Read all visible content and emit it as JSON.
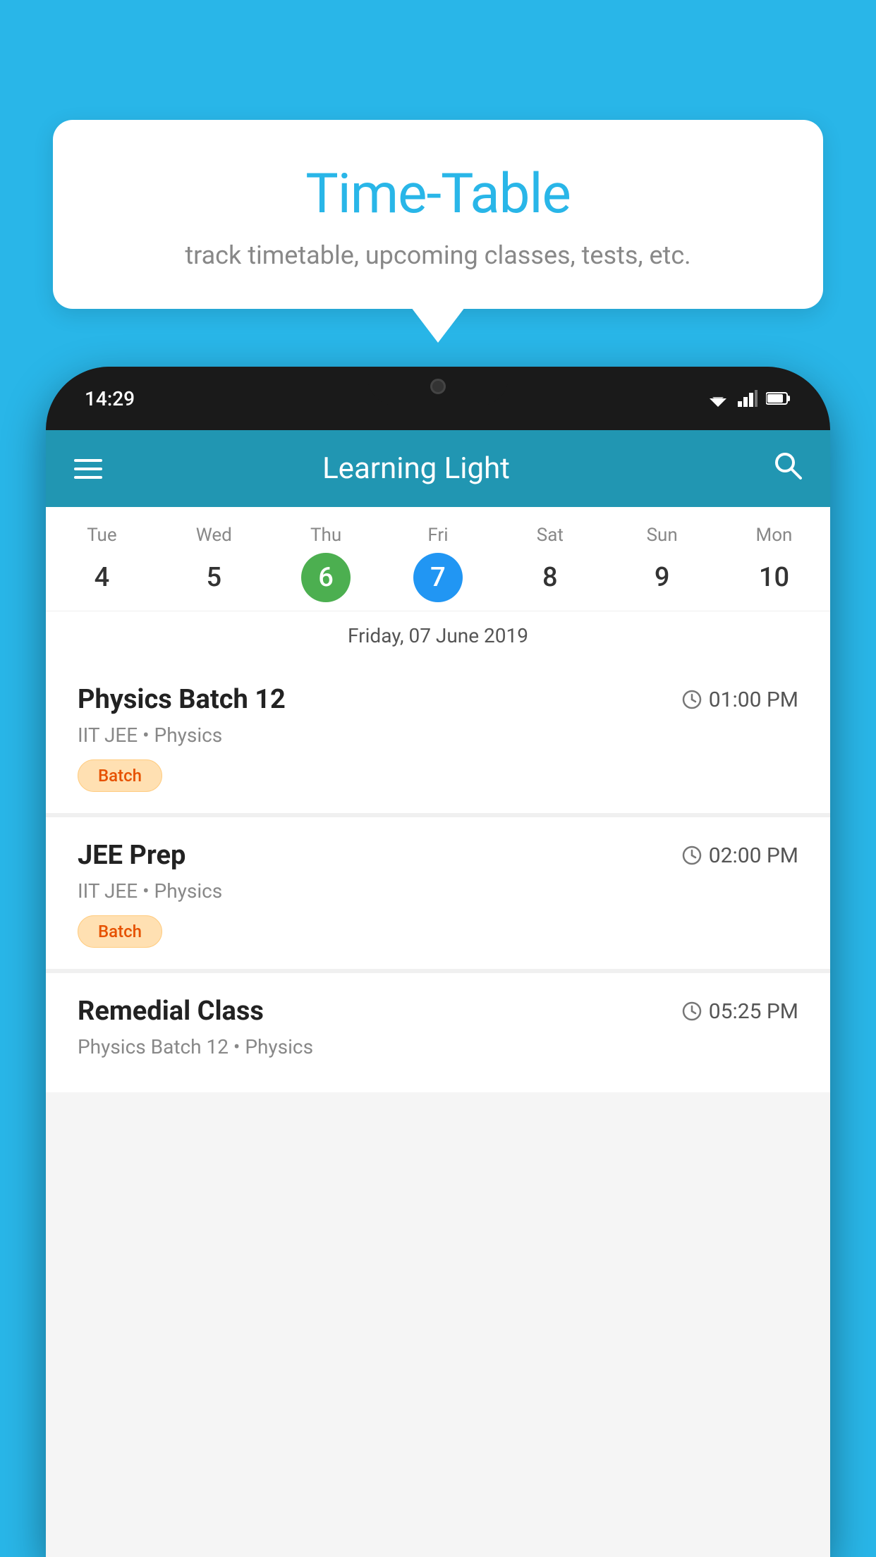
{
  "background_color": "#29B6E8",
  "tooltip": {
    "title": "Time-Table",
    "subtitle": "track timetable, upcoming classes, tests, etc."
  },
  "phone": {
    "status_time": "14:29",
    "app_title": "Learning Light",
    "selected_date_label": "Friday, 07 June 2019",
    "calendar": {
      "days": [
        {
          "label": "Tue",
          "number": "4",
          "state": "normal"
        },
        {
          "label": "Wed",
          "number": "5",
          "state": "normal"
        },
        {
          "label": "Thu",
          "number": "6",
          "state": "today"
        },
        {
          "label": "Fri",
          "number": "7",
          "state": "selected"
        },
        {
          "label": "Sat",
          "number": "8",
          "state": "normal"
        },
        {
          "label": "Sun",
          "number": "9",
          "state": "normal"
        },
        {
          "label": "Mon",
          "number": "10",
          "state": "normal"
        }
      ]
    },
    "schedule": [
      {
        "title": "Physics Batch 12",
        "time": "01:00 PM",
        "subtitle": "IIT JEE • Physics",
        "badge": "Batch"
      },
      {
        "title": "JEE Prep",
        "time": "02:00 PM",
        "subtitle": "IIT JEE • Physics",
        "badge": "Batch"
      },
      {
        "title": "Remedial Class",
        "time": "05:25 PM",
        "subtitle": "Physics Batch 12 • Physics",
        "badge": ""
      }
    ]
  }
}
